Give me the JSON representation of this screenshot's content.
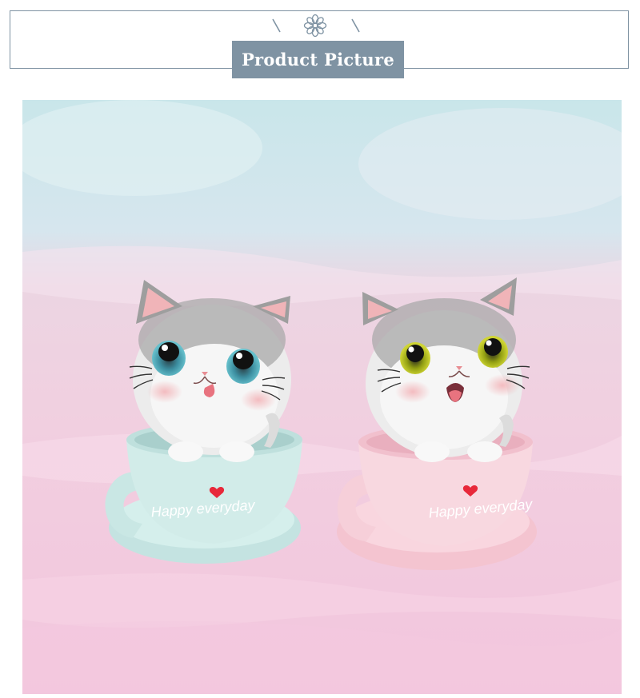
{
  "header": {
    "title": "Product Picture",
    "icon": "flower-icon",
    "accent_color": "#7f93a3"
  },
  "product_photo": {
    "figures": [
      {
        "name": "blue-cup-cat",
        "cup_text": "Happy everyday",
        "cup_color": "#cfe8e6"
      },
      {
        "name": "pink-cup-cat",
        "cup_text": "Happy everyday",
        "cup_color": "#f6d2dc"
      }
    ]
  }
}
